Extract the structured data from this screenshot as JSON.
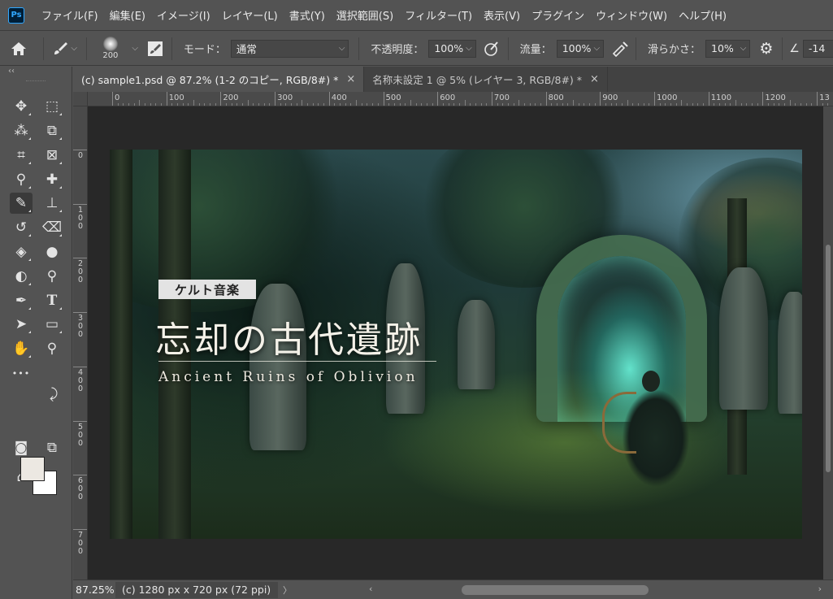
{
  "app": {
    "logo": "Ps"
  },
  "menu": {
    "items": [
      "ファイル(F)",
      "編集(E)",
      "イメージ(I)",
      "レイヤー(L)",
      "書式(Y)",
      "選択範囲(S)",
      "フィルター(T)",
      "表示(V)",
      "プラグイン",
      "ウィンドウ(W)",
      "ヘルプ(H)"
    ]
  },
  "options": {
    "brush_size": "200",
    "mode_label": "モード：",
    "mode_value": "通常",
    "opacity_label": "不透明度：",
    "opacity_value": "100%",
    "flow_label": "流量：",
    "flow_value": "100%",
    "smoothing_label": "滑らかさ：",
    "smoothing_value": "10%",
    "angle_value": "-14"
  },
  "toolbar": {
    "collapse": "‹‹",
    "tools": [
      {
        "name": "move-tool",
        "glyph": "✥"
      },
      {
        "name": "marquee-tool",
        "glyph": "⬚"
      },
      {
        "name": "quick-select-tool",
        "glyph": "⁂"
      },
      {
        "name": "object-select-tool",
        "glyph": "⧉"
      },
      {
        "name": "crop-tool",
        "glyph": "⌗"
      },
      {
        "name": "frame-tool",
        "glyph": "⊠"
      },
      {
        "name": "eyedropper-tool",
        "glyph": "⚲"
      },
      {
        "name": "healing-brush-tool",
        "glyph": "✚"
      },
      {
        "name": "brush-tool",
        "glyph": "✎"
      },
      {
        "name": "stamp-tool",
        "glyph": "⊥"
      },
      {
        "name": "history-brush-tool",
        "glyph": "↺"
      },
      {
        "name": "eraser-tool",
        "glyph": "⌫"
      },
      {
        "name": "paint-bucket-tool",
        "glyph": "◈"
      },
      {
        "name": "blur-tool",
        "glyph": "●"
      },
      {
        "name": "dodge-tool",
        "glyph": "◐"
      },
      {
        "name": "burn-tool",
        "glyph": "⚲"
      },
      {
        "name": "pen-tool",
        "glyph": "✒"
      },
      {
        "name": "type-tool",
        "glyph": "T"
      },
      {
        "name": "path-select-tool",
        "glyph": "➤"
      },
      {
        "name": "rectangle-tool",
        "glyph": "▭"
      },
      {
        "name": "hand-tool",
        "glyph": "✋"
      },
      {
        "name": "zoom-tool",
        "glyph": "⚲"
      },
      {
        "name": "more-tools",
        "glyph": "•••"
      },
      {
        "name": "swap-colors",
        "glyph": "⤸"
      },
      {
        "name": "quick-mask",
        "glyph": "◙"
      },
      {
        "name": "screen-mode",
        "glyph": "⧉"
      },
      {
        "name": "generative-tool",
        "glyph": "⌂"
      }
    ]
  },
  "tabs": [
    {
      "label": "(c) sample1.psd @ 87.2% (1-2 のコピー, RGB/8#) *",
      "close": "×"
    },
    {
      "label": "名称未設定 1 @ 5% (レイヤー 3, RGB/8#) *",
      "close": "×"
    }
  ],
  "ruler": {
    "top_labels": [
      "0",
      "100",
      "200",
      "300",
      "400",
      "500",
      "600",
      "700",
      "800",
      "900",
      "1000",
      "1100",
      "1200",
      "13"
    ],
    "left_labels": [
      "0",
      "100",
      "200",
      "300",
      "400",
      "500",
      "600",
      "700"
    ]
  },
  "artwork": {
    "tag": "ケルト音楽",
    "title": "忘却の古代遺跡",
    "subtitle": "Ancient Ruins of Oblivion"
  },
  "status": {
    "zoom": "87.25%",
    "doc_info": "(c) 1280 px x 720 px (72 ppi)",
    "expand": "〉",
    "left_arrow": "‹",
    "right_arrow": "›"
  },
  "colors": {
    "foreground": "#ece8e2",
    "background": "#ffffff"
  }
}
